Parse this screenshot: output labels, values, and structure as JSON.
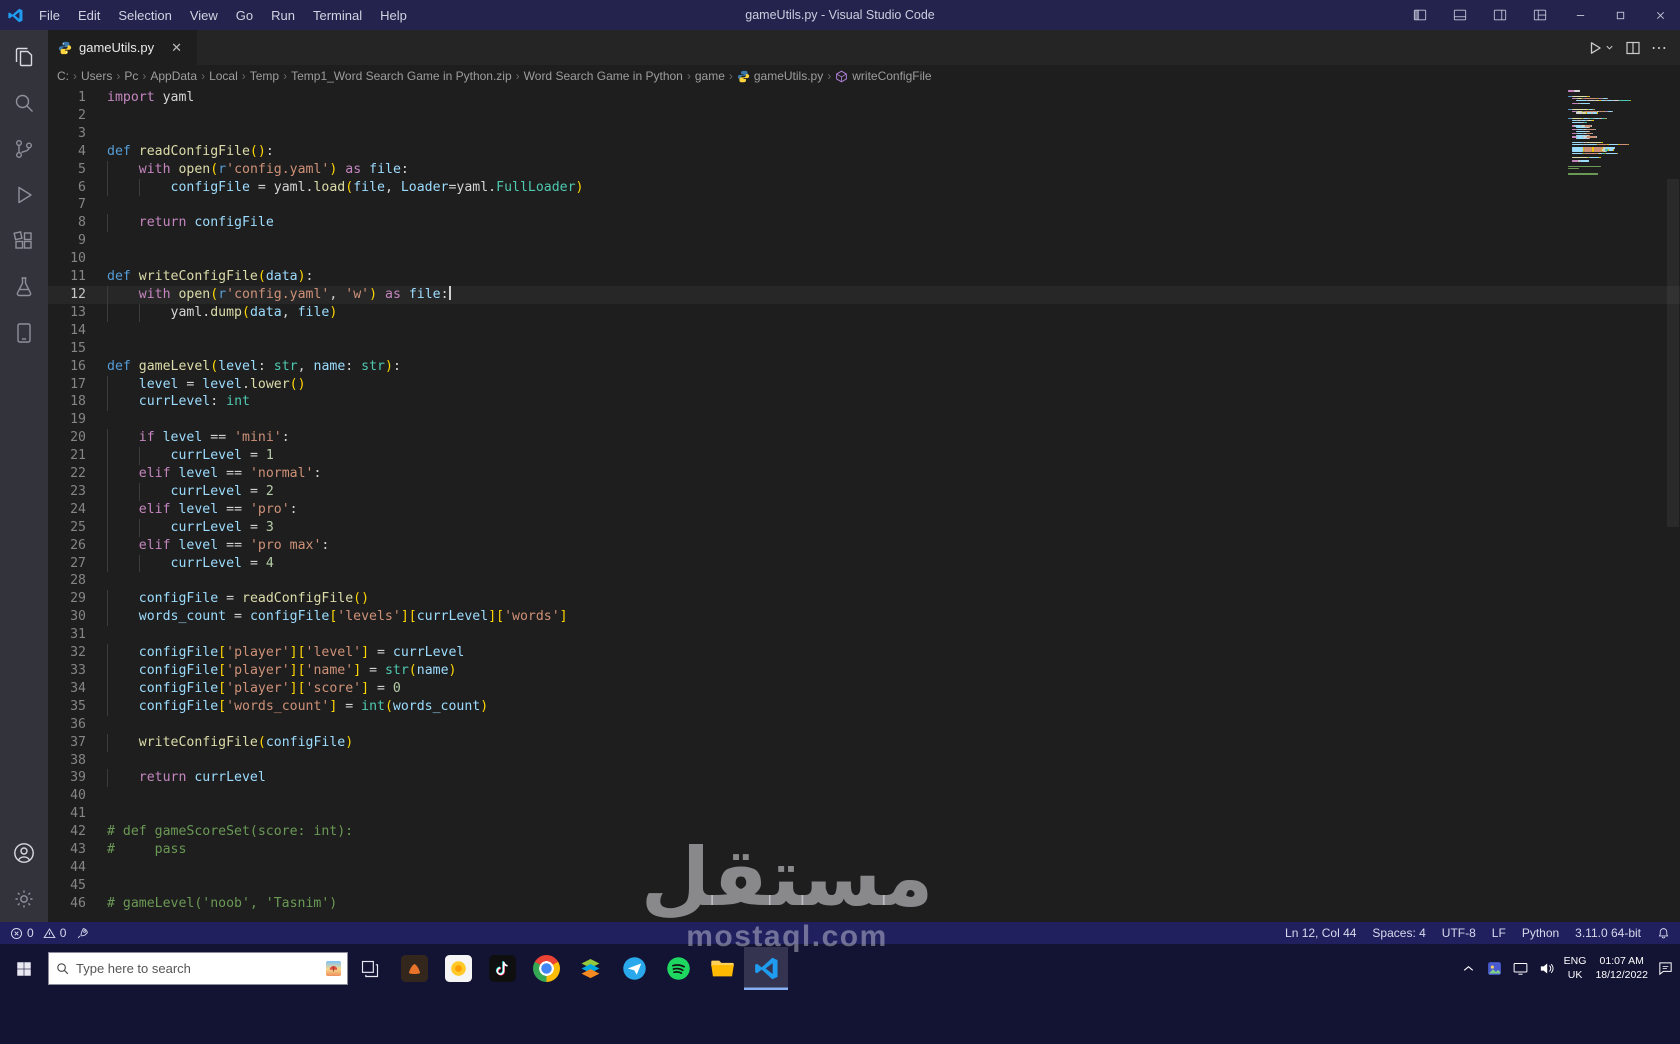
{
  "titlebar": {
    "menus": [
      "File",
      "Edit",
      "Selection",
      "View",
      "Go",
      "Run",
      "Terminal",
      "Help"
    ],
    "title": "gameUtils.py - Visual Studio Code"
  },
  "activity_bar": {
    "top": [
      "explorer",
      "search",
      "source-control",
      "run-and-debug",
      "extensions",
      "testing",
      "remote-explorer"
    ],
    "bottom": [
      "accounts",
      "manage"
    ]
  },
  "tab": {
    "label": "gameUtils.py"
  },
  "breadcrumb": {
    "path": [
      "C:",
      "Users",
      "Pc",
      "AppData",
      "Local",
      "Temp",
      "Temp1_Word Search Game in Python.zip",
      "Word Search Game in Python",
      "game"
    ],
    "file": "gameUtils.py",
    "symbol": "writeConfigFile"
  },
  "editor": {
    "active_line": 12,
    "colors": {
      "kw": "#C586C0",
      "df": "#569CD6",
      "fn": "#DCDCAA",
      "cl": "#4EC9B0",
      "st": "#CE9178",
      "vr": "#9CDCFE",
      "nu": "#B5CEA8",
      "pl": "#D4D4D4",
      "br": "#FFD700",
      "cm": "#6A9955",
      "in": "#D4D4D4"
    },
    "lines": [
      {
        "n": 1,
        "t": [
          [
            "kw",
            "import"
          ],
          [
            "pl",
            " yaml"
          ]
        ]
      },
      {
        "n": 2,
        "t": []
      },
      {
        "n": 3,
        "t": []
      },
      {
        "n": 4,
        "t": [
          [
            "df",
            "def "
          ],
          [
            "fn",
            "readConfigFile"
          ],
          [
            "br",
            "()"
          ],
          [
            "pl",
            ":"
          ]
        ]
      },
      {
        "n": 5,
        "t": [
          [
            "in",
            "    "
          ],
          [
            "kw",
            "with"
          ],
          [
            "pl",
            " "
          ],
          [
            "fn",
            "open"
          ],
          [
            "br",
            "("
          ],
          [
            "df",
            "r"
          ],
          [
            "st",
            "'config.yaml'"
          ],
          [
            "br",
            ")"
          ],
          [
            "pl",
            " "
          ],
          [
            "kw",
            "as"
          ],
          [
            "pl",
            " "
          ],
          [
            "vr",
            "file"
          ],
          [
            "pl",
            ":"
          ]
        ]
      },
      {
        "n": 6,
        "t": [
          [
            "in",
            "        "
          ],
          [
            "vr",
            "configFile"
          ],
          [
            "pl",
            " = yaml."
          ],
          [
            "fn",
            "load"
          ],
          [
            "br",
            "("
          ],
          [
            "vr",
            "file"
          ],
          [
            "pl",
            ", "
          ],
          [
            "vr",
            "Loader"
          ],
          [
            "pl",
            "=yaml."
          ],
          [
            "cl",
            "FullLoader"
          ],
          [
            "br",
            ")"
          ]
        ]
      },
      {
        "n": 7,
        "t": []
      },
      {
        "n": 8,
        "t": [
          [
            "in",
            "    "
          ],
          [
            "kw",
            "return"
          ],
          [
            "pl",
            " "
          ],
          [
            "vr",
            "configFile"
          ]
        ]
      },
      {
        "n": 9,
        "t": []
      },
      {
        "n": 10,
        "t": []
      },
      {
        "n": 11,
        "t": [
          [
            "df",
            "def "
          ],
          [
            "fn",
            "writeConfigFile"
          ],
          [
            "br",
            "("
          ],
          [
            "vr",
            "data"
          ],
          [
            "br",
            ")"
          ],
          [
            "pl",
            ":"
          ]
        ]
      },
      {
        "n": 12,
        "t": [
          [
            "in",
            "    "
          ],
          [
            "kw",
            "with"
          ],
          [
            "pl",
            " "
          ],
          [
            "fn",
            "open"
          ],
          [
            "br",
            "("
          ],
          [
            "df",
            "r"
          ],
          [
            "st",
            "'config.yaml'"
          ],
          [
            "pl",
            ", "
          ],
          [
            "st",
            "'w'"
          ],
          [
            "br",
            ")"
          ],
          [
            "pl",
            " "
          ],
          [
            "kw",
            "as"
          ],
          [
            "pl",
            " "
          ],
          [
            "vr",
            "file"
          ],
          [
            "pl",
            ":"
          ]
        ]
      },
      {
        "n": 13,
        "t": [
          [
            "in",
            "        "
          ],
          [
            "pl",
            "yaml."
          ],
          [
            "fn",
            "dump"
          ],
          [
            "br",
            "("
          ],
          [
            "vr",
            "data"
          ],
          [
            "pl",
            ", "
          ],
          [
            "vr",
            "file"
          ],
          [
            "br",
            ")"
          ]
        ]
      },
      {
        "n": 14,
        "t": []
      },
      {
        "n": 15,
        "t": []
      },
      {
        "n": 16,
        "t": [
          [
            "df",
            "def "
          ],
          [
            "fn",
            "gameLevel"
          ],
          [
            "br",
            "("
          ],
          [
            "vr",
            "level"
          ],
          [
            "pl",
            ": "
          ],
          [
            "cl",
            "str"
          ],
          [
            "pl",
            ", "
          ],
          [
            "vr",
            "name"
          ],
          [
            "pl",
            ": "
          ],
          [
            "cl",
            "str"
          ],
          [
            "br",
            ")"
          ],
          [
            "pl",
            ":"
          ]
        ]
      },
      {
        "n": 17,
        "t": [
          [
            "in",
            "    "
          ],
          [
            "vr",
            "level"
          ],
          [
            "pl",
            " = "
          ],
          [
            "vr",
            "level"
          ],
          [
            "pl",
            "."
          ],
          [
            "fn",
            "lower"
          ],
          [
            "br",
            "()"
          ]
        ]
      },
      {
        "n": 18,
        "t": [
          [
            "in",
            "    "
          ],
          [
            "vr",
            "currLevel"
          ],
          [
            "pl",
            ": "
          ],
          [
            "cl",
            "int"
          ]
        ]
      },
      {
        "n": 19,
        "t": []
      },
      {
        "n": 20,
        "t": [
          [
            "in",
            "    "
          ],
          [
            "kw",
            "if"
          ],
          [
            "pl",
            " "
          ],
          [
            "vr",
            "level"
          ],
          [
            "pl",
            " == "
          ],
          [
            "st",
            "'mini'"
          ],
          [
            "pl",
            ":"
          ]
        ]
      },
      {
        "n": 21,
        "t": [
          [
            "in",
            "        "
          ],
          [
            "vr",
            "currLevel"
          ],
          [
            "pl",
            " = "
          ],
          [
            "nu",
            "1"
          ]
        ]
      },
      {
        "n": 22,
        "t": [
          [
            "in",
            "    "
          ],
          [
            "kw",
            "elif"
          ],
          [
            "pl",
            " "
          ],
          [
            "vr",
            "level"
          ],
          [
            "pl",
            " == "
          ],
          [
            "st",
            "'normal'"
          ],
          [
            "pl",
            ":"
          ]
        ]
      },
      {
        "n": 23,
        "t": [
          [
            "in",
            "        "
          ],
          [
            "vr",
            "currLevel"
          ],
          [
            "pl",
            " = "
          ],
          [
            "nu",
            "2"
          ]
        ]
      },
      {
        "n": 24,
        "t": [
          [
            "in",
            "    "
          ],
          [
            "kw",
            "elif"
          ],
          [
            "pl",
            " "
          ],
          [
            "vr",
            "level"
          ],
          [
            "pl",
            " == "
          ],
          [
            "st",
            "'pro'"
          ],
          [
            "pl",
            ":"
          ]
        ]
      },
      {
        "n": 25,
        "t": [
          [
            "in",
            "        "
          ],
          [
            "vr",
            "currLevel"
          ],
          [
            "pl",
            " = "
          ],
          [
            "nu",
            "3"
          ]
        ]
      },
      {
        "n": 26,
        "t": [
          [
            "in",
            "    "
          ],
          [
            "kw",
            "elif"
          ],
          [
            "pl",
            " "
          ],
          [
            "vr",
            "level"
          ],
          [
            "pl",
            " == "
          ],
          [
            "st",
            "'pro max'"
          ],
          [
            "pl",
            ":"
          ]
        ]
      },
      {
        "n": 27,
        "t": [
          [
            "in",
            "        "
          ],
          [
            "vr",
            "currLevel"
          ],
          [
            "pl",
            " = "
          ],
          [
            "nu",
            "4"
          ]
        ]
      },
      {
        "n": 28,
        "t": []
      },
      {
        "n": 29,
        "t": [
          [
            "in",
            "    "
          ],
          [
            "vr",
            "configFile"
          ],
          [
            "pl",
            " = "
          ],
          [
            "fn",
            "readConfigFile"
          ],
          [
            "br",
            "()"
          ]
        ]
      },
      {
        "n": 30,
        "t": [
          [
            "in",
            "    "
          ],
          [
            "vr",
            "words_count"
          ],
          [
            "pl",
            " = "
          ],
          [
            "vr",
            "configFile"
          ],
          [
            "br",
            "["
          ],
          [
            "st",
            "'levels'"
          ],
          [
            "br",
            "]["
          ],
          [
            "vr",
            "currLevel"
          ],
          [
            "br",
            "]["
          ],
          [
            "st",
            "'words'"
          ],
          [
            "br",
            "]"
          ]
        ]
      },
      {
        "n": 31,
        "t": []
      },
      {
        "n": 32,
        "t": [
          [
            "in",
            "    "
          ],
          [
            "vr",
            "configFile"
          ],
          [
            "br",
            "["
          ],
          [
            "st",
            "'player'"
          ],
          [
            "br",
            "]["
          ],
          [
            "st",
            "'level'"
          ],
          [
            "br",
            "]"
          ],
          [
            "pl",
            " = "
          ],
          [
            "vr",
            "currLevel"
          ]
        ]
      },
      {
        "n": 33,
        "t": [
          [
            "in",
            "    "
          ],
          [
            "vr",
            "configFile"
          ],
          [
            "br",
            "["
          ],
          [
            "st",
            "'player'"
          ],
          [
            "br",
            "]["
          ],
          [
            "st",
            "'name'"
          ],
          [
            "br",
            "]"
          ],
          [
            "pl",
            " = "
          ],
          [
            "cl",
            "str"
          ],
          [
            "br",
            "("
          ],
          [
            "vr",
            "name"
          ],
          [
            "br",
            ")"
          ]
        ]
      },
      {
        "n": 34,
        "t": [
          [
            "in",
            "    "
          ],
          [
            "vr",
            "configFile"
          ],
          [
            "br",
            "["
          ],
          [
            "st",
            "'player'"
          ],
          [
            "br",
            "]["
          ],
          [
            "st",
            "'score'"
          ],
          [
            "br",
            "]"
          ],
          [
            "pl",
            " = "
          ],
          [
            "nu",
            "0"
          ]
        ]
      },
      {
        "n": 35,
        "t": [
          [
            "in",
            "    "
          ],
          [
            "vr",
            "configFile"
          ],
          [
            "br",
            "["
          ],
          [
            "st",
            "'words_count'"
          ],
          [
            "br",
            "]"
          ],
          [
            "pl",
            " = "
          ],
          [
            "cl",
            "int"
          ],
          [
            "br",
            "("
          ],
          [
            "vr",
            "words_count"
          ],
          [
            "br",
            ")"
          ]
        ]
      },
      {
        "n": 36,
        "t": []
      },
      {
        "n": 37,
        "t": [
          [
            "in",
            "    "
          ],
          [
            "fn",
            "writeConfigFile"
          ],
          [
            "br",
            "("
          ],
          [
            "vr",
            "configFile"
          ],
          [
            "br",
            ")"
          ]
        ]
      },
      {
        "n": 38,
        "t": []
      },
      {
        "n": 39,
        "t": [
          [
            "in",
            "    "
          ],
          [
            "kw",
            "return"
          ],
          [
            "pl",
            " "
          ],
          [
            "vr",
            "currLevel"
          ]
        ]
      },
      {
        "n": 40,
        "t": []
      },
      {
        "n": 41,
        "t": []
      },
      {
        "n": 42,
        "t": [
          [
            "cm",
            "# def gameScoreSet(score: int):"
          ]
        ]
      },
      {
        "n": 43,
        "t": [
          [
            "cm",
            "#     pass"
          ]
        ]
      },
      {
        "n": 44,
        "t": []
      },
      {
        "n": 45,
        "t": []
      },
      {
        "n": 46,
        "t": [
          [
            "cm",
            "# gameLevel('noob', 'Tasnim')"
          ]
        ]
      }
    ]
  },
  "statusbar": {
    "errors": "0",
    "warnings": "0",
    "right": [
      {
        "name": "cursor-position",
        "label": "Ln 12, Col 44"
      },
      {
        "name": "indentation",
        "label": "Spaces: 4"
      },
      {
        "name": "encoding",
        "label": "UTF-8"
      },
      {
        "name": "eol",
        "label": "LF"
      },
      {
        "name": "language-mode",
        "label": "Python"
      },
      {
        "name": "python-interpreter",
        "label": "3.11.0 64-bit"
      }
    ]
  },
  "taskbar": {
    "search_placeholder": "Type here to search",
    "apps": [
      "game-app",
      "yellow-app",
      "tiktok",
      "chrome",
      "bluestacks",
      "blue-app",
      "spotify",
      "file-explorer",
      "vscode"
    ],
    "active_app": "vscode",
    "tray": {
      "lang": "ENG",
      "region": "UK",
      "time": "01:07 AM",
      "date": "18/12/2022"
    }
  },
  "watermark": {
    "arabic": "مستقل",
    "latin": "mostaql.com"
  }
}
